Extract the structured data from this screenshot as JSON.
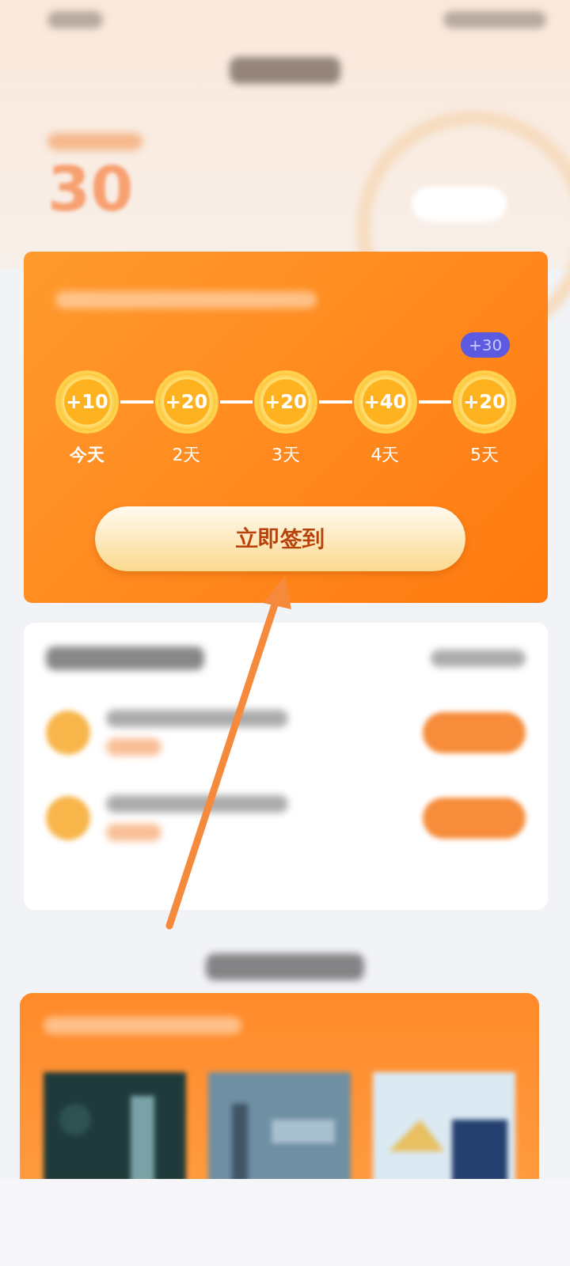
{
  "balance": "30",
  "checkin": {
    "days": [
      {
        "amount": "+10",
        "label": "今天",
        "selected": true
      },
      {
        "amount": "+20",
        "label": "2天",
        "selected": false
      },
      {
        "amount": "+20",
        "label": "3天",
        "selected": false
      },
      {
        "amount": "+40",
        "label": "4天",
        "selected": false
      },
      {
        "amount": "+20",
        "label": "5天",
        "selected": false,
        "badge": "+30"
      }
    ],
    "button": "立即签到"
  }
}
